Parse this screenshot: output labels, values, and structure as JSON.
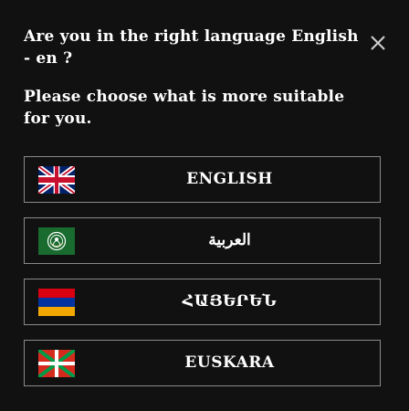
{
  "dialog": {
    "question": "Are you in the right language English - en ?",
    "prompt": "Please choose what is more suitable for you.",
    "close_icon": "close-icon"
  },
  "languages": [
    {
      "label": "ENGLISH",
      "flag": "uk-flag"
    },
    {
      "label": "العربية",
      "flag": "arab-league-flag"
    },
    {
      "label": "ՀԱՅԵՐԵՆ",
      "flag": "armenia-flag"
    },
    {
      "label": "EUSKARA",
      "flag": "basque-flag"
    }
  ],
  "colors": {
    "background": "#111111",
    "border": "#8a8a8a",
    "text": "#ffffff"
  }
}
